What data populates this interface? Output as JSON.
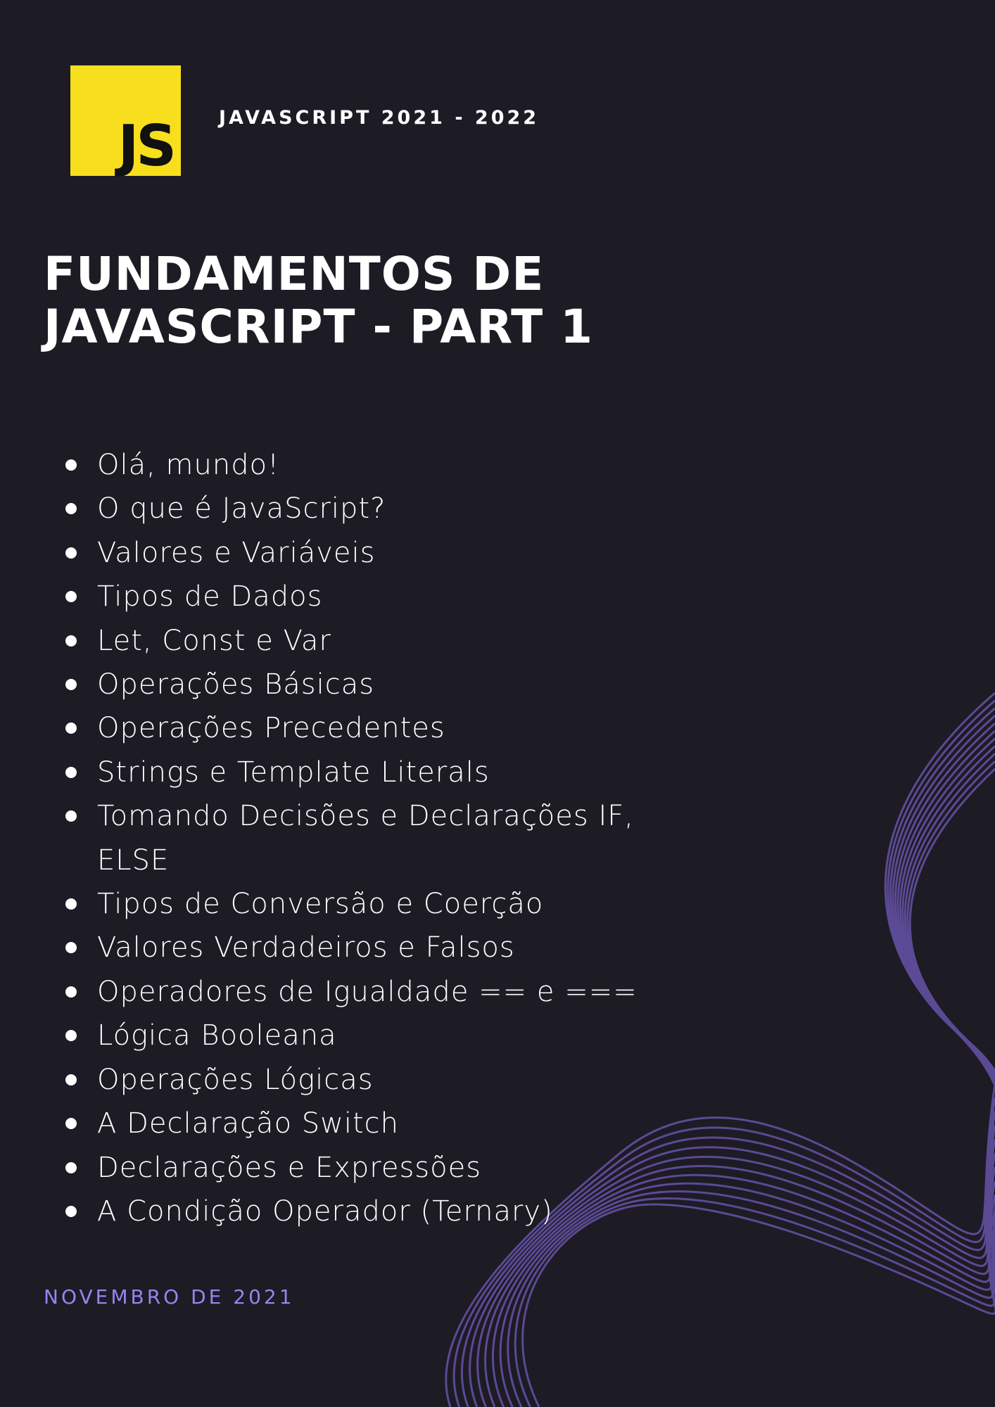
{
  "header": {
    "logo_text": "JS",
    "course_label": "JAVASCRIPT 2021 - 2022"
  },
  "title": {
    "line1": "FUNDAMENTOS DE",
    "line2": "JAVASCRIPT - PART 1"
  },
  "topics": [
    "Olá, mundo!",
    "O que é JavaScript?",
    "Valores e Variáveis",
    "Tipos de Dados",
    "Let, Const e Var",
    "Operações Básicas",
    "Operações Precedentes",
    "Strings e Template Literals",
    "Tomando Decisões e Declarações IF, ELSE",
    "Tipos de Conversão e Coerção",
    "Valores Verdadeiros e Falsos",
    "Operadores de Igualdade == e ===",
    "Lógica Booleana",
    "Operações Lógicas",
    "A Declaração Switch",
    "Declarações e Expressões",
    "A Condição Operador (Ternary)"
  ],
  "footer": {
    "date": "NOVEMBRO DE 2021"
  },
  "colors": {
    "background": "#1d1b24",
    "logo": "#f7df1e",
    "text": "#ffffff",
    "accent": "#9a83ee",
    "waves": "#5b4a94"
  }
}
